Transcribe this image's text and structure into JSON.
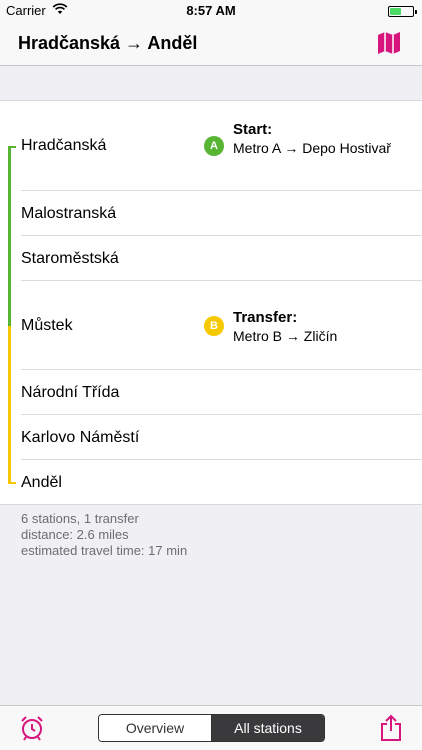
{
  "status_bar": {
    "carrier": "Carrier",
    "time": "8:57 AM"
  },
  "nav": {
    "title": "Hradčanská → Anděl",
    "map_icon": "map-icon"
  },
  "colors": {
    "line_a": "#58b533",
    "line_b": "#f6c800",
    "accent": "#d6157d"
  },
  "stations": [
    {
      "name": "Hradčanská",
      "line": "A"
    },
    {
      "name": "Malostranská",
      "line": "A"
    },
    {
      "name": "Staroměstská",
      "line": "A"
    },
    {
      "name": "Můstek",
      "line": "B"
    },
    {
      "name": "Národní Třída",
      "line": "B"
    },
    {
      "name": "Karlovo Náměstí",
      "line": "B"
    },
    {
      "name": "Anděl",
      "line": "B"
    }
  ],
  "start": {
    "badge": "A",
    "title": "Start:",
    "detail": "Metro A → Depo Hostivař"
  },
  "transfer": {
    "badge": "B",
    "title": "Transfer:",
    "detail": "Metro B → Zličín"
  },
  "summary": {
    "stations": "6 stations, 1 transfer",
    "distance": "distance: 2.6 miles",
    "time": "estimated travel time: 17 min"
  },
  "tabs": {
    "overview": "Overview",
    "all_stations": "All stations",
    "selected": "All stations"
  }
}
